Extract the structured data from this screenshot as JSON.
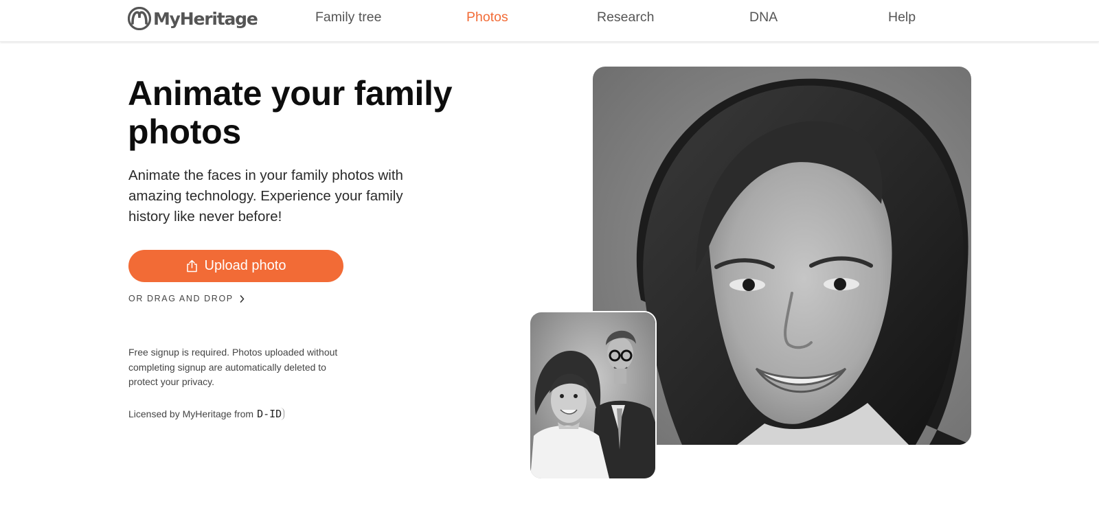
{
  "header": {
    "logo_text": "MyHeritage",
    "logo_icon": "myheritage-logo-icon",
    "nav": [
      {
        "label": "Family tree",
        "active": false
      },
      {
        "label": "Photos",
        "active": true
      },
      {
        "label": "Research",
        "active": false
      },
      {
        "label": "DNA",
        "active": false
      },
      {
        "label": "Help",
        "active": false
      }
    ]
  },
  "hero": {
    "title": "Animate your family photos",
    "description": "Animate the faces in your family photos with amazing technology. Experience your family history like never before!",
    "upload_button": {
      "label": "Upload photo",
      "icon": "upload-icon"
    },
    "drag_drop_label": "OR DRAG AND DROP",
    "notice": "Free signup is required. Photos uploaded without completing signup are automatically deleted to protect your privacy.",
    "licensed_text": "Licensed by MyHeritage from",
    "licensor_logo_text": "D-ID"
  },
  "colors": {
    "accent": "#f26b36",
    "nav_text": "#555555",
    "heading": "#0d0d0d"
  }
}
